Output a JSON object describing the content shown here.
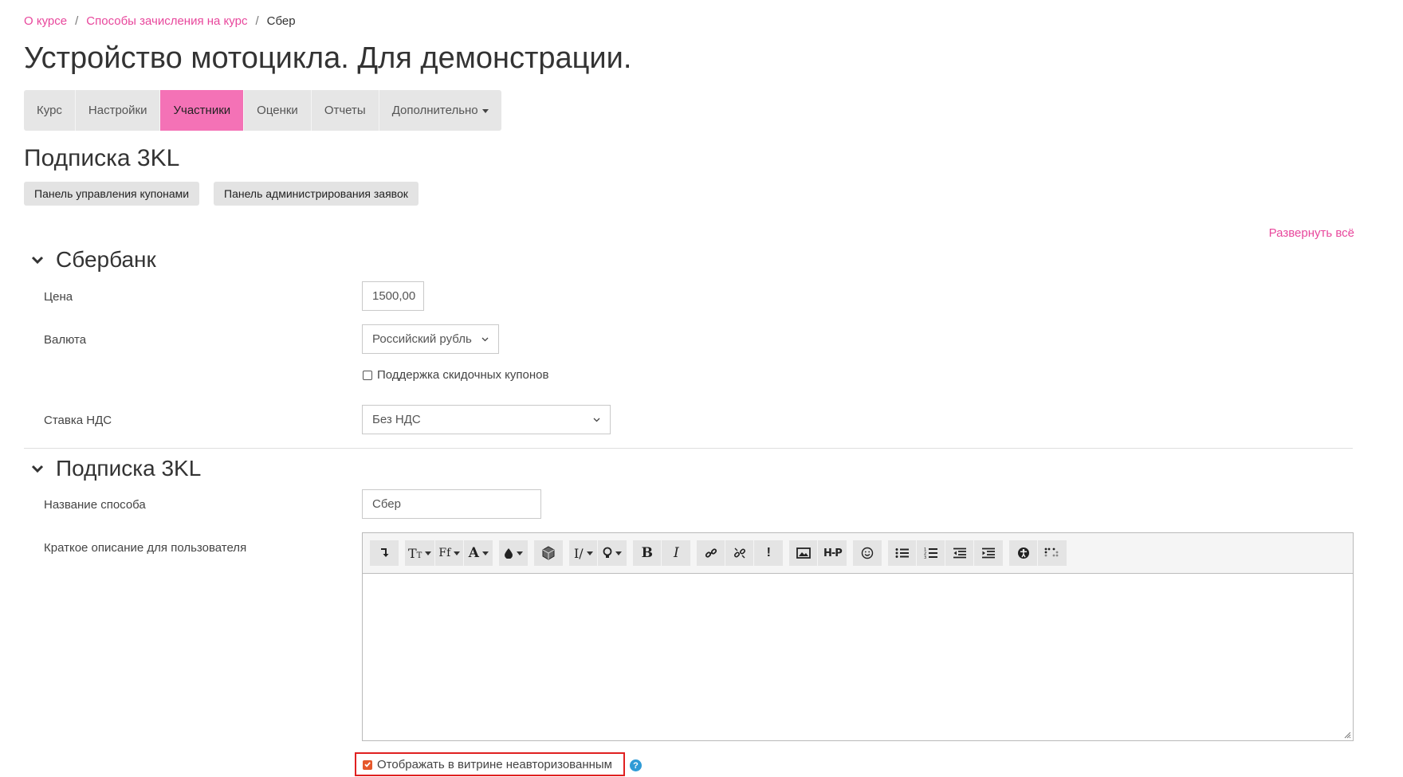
{
  "breadcrumb": {
    "items": [
      "О курсе",
      "Способы зачисления на курс"
    ],
    "current": "Сбер",
    "separator": "/"
  },
  "page_title": "Устройство мотоцикла. Для демонстрации.",
  "nav": {
    "tabs": [
      "Курс",
      "Настройки",
      "Участники",
      "Оценки",
      "Отчеты",
      "Дополнительно"
    ],
    "active": "Участники"
  },
  "section_title": "Подписка 3KL",
  "buttons": {
    "coupons": "Панель управления купонами",
    "requests": "Панель администрирования заявок"
  },
  "expand_all": "Развернуть всё",
  "sber_section": {
    "title": "Сбербанк",
    "price_label": "Цена",
    "price_value": "1500,00",
    "currency_label": "Валюта",
    "currency_value": "Российский рубль",
    "coupon_support_label": "Поддержка скидочных купонов",
    "coupon_support_checked": false,
    "vat_label": "Ставка НДС",
    "vat_value": "Без НДС"
  },
  "sub_section": {
    "title": "Подписка 3KL",
    "method_name_label": "Название способа",
    "method_name_value": "Сбер",
    "description_label": "Краткое описание для пользователя",
    "description_value": "",
    "showcase_label": "Отображать в витрине неавторизованным",
    "showcase_checked": true,
    "help_icon": "?"
  },
  "toolbar_icons": [
    "collapse-icon",
    "font-size-icon",
    "font-family-icon",
    "font-color-icon",
    "background-color-icon",
    "package-icon",
    "styles-icon",
    "ideas-icon",
    "bold-icon",
    "italic-icon",
    "link-icon",
    "unlink-icon",
    "alert-icon",
    "image-icon",
    "h5p-icon",
    "emoji-icon",
    "unordered-list-icon",
    "ordered-list-icon",
    "outdent-icon",
    "indent-icon",
    "accessibility-icon",
    "braille-icon"
  ],
  "colors": {
    "accent": "#e8479c",
    "active_tab": "#f472b6",
    "checkbox_checked": "#e5582b",
    "highlight_border": "#e02020",
    "help": "#2f9bd6"
  }
}
